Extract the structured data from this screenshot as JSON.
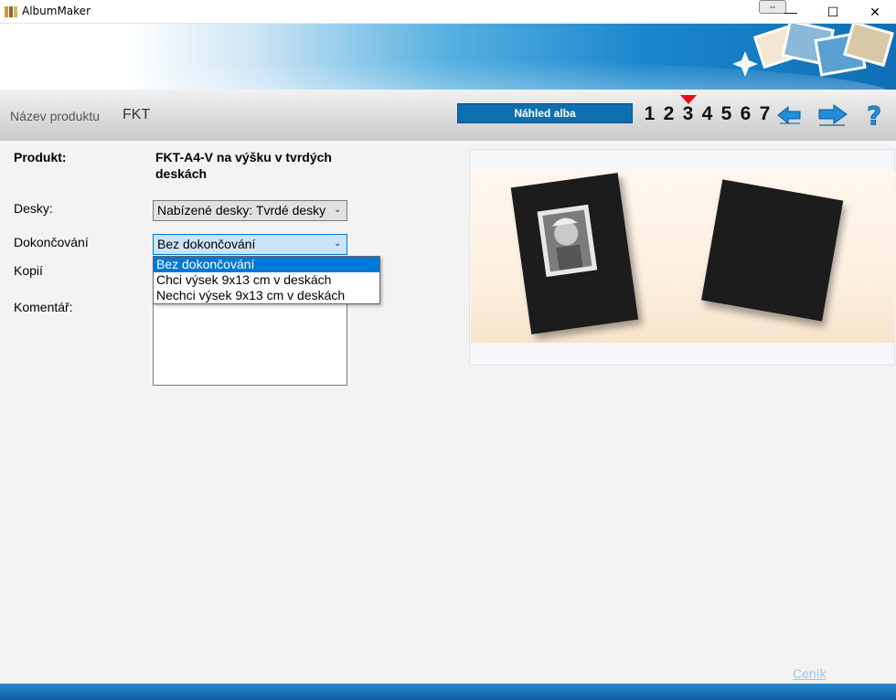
{
  "window": {
    "title": "AlbumMaker",
    "controls": {
      "minimize": "—",
      "maximize": "☐",
      "close": "✕"
    }
  },
  "toolbar": {
    "product_name_label": "Název produktu",
    "product_name_value": "FKT",
    "step_title": "Náhled alba",
    "steps": [
      "1",
      "2",
      "3",
      "4",
      "5",
      "6",
      "7"
    ],
    "current_step": "3",
    "icons": {
      "back": "arrow-left-icon",
      "forward": "arrow-right-icon",
      "help": "question-mark-icon"
    }
  },
  "form": {
    "product_label": "Produkt:",
    "product_value": "FKT-A4-V na výšku v tvrdých deskách",
    "covers_label": "Desky:",
    "covers_value": "Nabízené desky: Tvrdé desky",
    "finishing_label": "Dokončování",
    "finishing_value": "Bez dokončování",
    "finishing_options": [
      "Bez dokončování",
      "Chci výsek 9x13 cm v deskách",
      "Nechci výsek 9x13 cm v deskách"
    ],
    "copies_label": "Kopií",
    "comment_label": "Komentář:"
  },
  "footer": {
    "pricelist_link": "Ceník"
  },
  "colors": {
    "accent": "#0e6fb0",
    "selection": "#0078d7",
    "marker": "#e3101c",
    "link": "#9cc6e8"
  }
}
